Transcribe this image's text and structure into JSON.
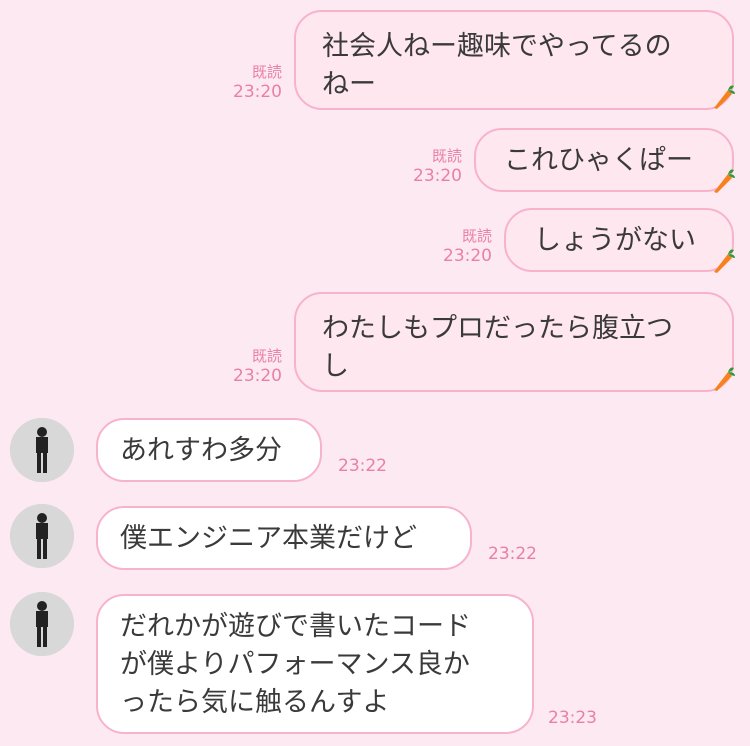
{
  "messages": [
    {
      "dir": "out",
      "text": "社会人ねー趣味でやってるの\nねー",
      "read": "既読",
      "time": "23:20"
    },
    {
      "dir": "out",
      "text": "これひゃくぱー",
      "read": "既読",
      "time": "23:20"
    },
    {
      "dir": "out",
      "text": "しょうがない",
      "read": "既読",
      "time": "23:20"
    },
    {
      "dir": "out",
      "text": "わたしもプロだったら腹立つ\nし",
      "read": "既読",
      "time": "23:20"
    },
    {
      "dir": "in",
      "text": "あれすわ多分",
      "time": "23:22"
    },
    {
      "dir": "in",
      "text": "僕エンジニア本業だけど",
      "time": "23:22"
    },
    {
      "dir": "in",
      "text": "だれかが遊びで書いたコード\nが僕よりパフォーマンス良か\nったら気に触るんすよ",
      "time": "23:23"
    }
  ],
  "colors": {
    "background": "#fde9f2",
    "bubble_out": "#ffe7ef",
    "bubble_in": "#ffffff",
    "border": "#f7b3cc",
    "meta": "#e97fa8"
  },
  "icons": {
    "sticker": "carrot-icon",
    "avatar": "person-photo"
  }
}
